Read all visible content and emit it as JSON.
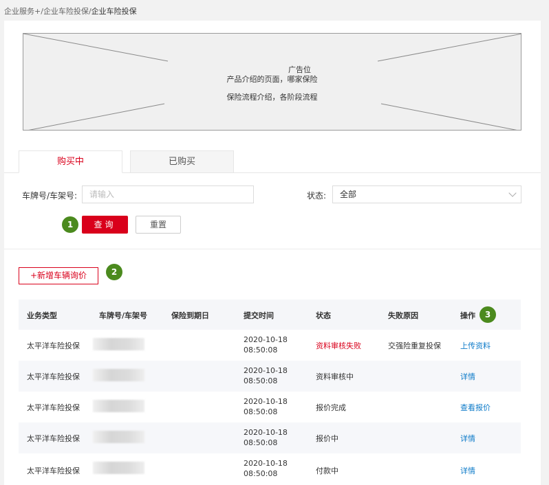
{
  "breadcrumb": {
    "item1": "企业服务",
    "sep1": "+/",
    "item2": "企业车险投保",
    "sep2": "/",
    "current": "企业车险投保"
  },
  "ad": {
    "title": "广告位",
    "line1": "产品介绍的页面，哪家保险",
    "line2": "保险流程介绍，各阶段流程"
  },
  "tabs": [
    {
      "label": "购买中"
    },
    {
      "label": "已购买"
    }
  ],
  "filters": {
    "plate_label": "车牌号/车架号:",
    "plate_placeholder": "请输入",
    "status_label": "状态:",
    "status_value": "全部"
  },
  "buttons": {
    "query": "查询",
    "reset": "重置",
    "add_vehicle": "+新增车辆询价"
  },
  "badges": {
    "b1": "1",
    "b2": "2",
    "b3": "3"
  },
  "table": {
    "headers": {
      "type": "业务类型",
      "plate": "车牌号/车架号",
      "expiry": "保险到期日",
      "submit": "提交时间",
      "status": "状态",
      "reason": "失败原因",
      "action": "操作"
    },
    "rows": [
      {
        "type": "太平洋车险投保",
        "date": "2020-10-18",
        "time": "08:50:08",
        "status": "资料审核失败",
        "reason": "交强险重复投保",
        "action": "上传资料"
      },
      {
        "type": "太平洋车险投保",
        "date": "2020-10-18",
        "time": "08:50:08",
        "status": "资料审核中",
        "reason": "",
        "action": "详情"
      },
      {
        "type": "太平洋车险投保",
        "date": "2020-10-18",
        "time": "08:50:08",
        "status": "报价完成",
        "reason": "",
        "action": "查看报价"
      },
      {
        "type": "太平洋车险投保",
        "date": "2020-10-18",
        "time": "08:50:08",
        "status": "报价中",
        "reason": "",
        "action": "详情"
      },
      {
        "type": "太平洋车险投保",
        "date": "2020-10-18",
        "time": "08:50:08",
        "status": "付款中",
        "reason": "",
        "action": "详情"
      }
    ]
  },
  "colors": {
    "accent": "#d9001b",
    "link": "#0c7ac8",
    "badge": "#4b8a1e"
  }
}
